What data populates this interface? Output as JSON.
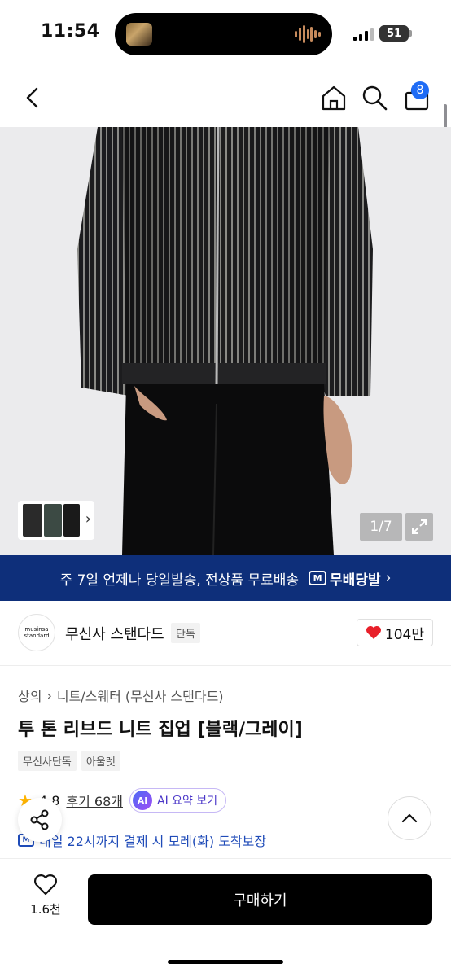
{
  "status_bar": {
    "time": "11:54",
    "battery": "51"
  },
  "nav": {
    "cart_count": "8"
  },
  "gallery": {
    "counter": "1/7"
  },
  "banner": {
    "text": "주 7일 언제나 당일발송, 전상품 무료배송",
    "brand": "무배당발",
    "chevron": "›"
  },
  "brand": {
    "logo_line1": "musinsa",
    "logo_line2": "standard",
    "name": "무신사 스탠다드",
    "exclusive_tag": "단독",
    "likes": "104만",
    "heart_color": "#e8202a"
  },
  "product": {
    "breadcrumb": [
      "상의",
      "니트/스웨터 (무신사 스탠다드)"
    ],
    "title": "투 톤 리브드 니트 집업 [블랙/그레이]",
    "tags": [
      "무신사단독",
      "아울렛"
    ],
    "rating": "4.8",
    "review_link": "후기 68개",
    "ai_badge": "AI",
    "ai_label": "AI 요약 보기",
    "delivery_text": "내일 22시까지 결제 시 모레(화) 도착보장",
    "delivery_badge": "M"
  },
  "bottom_bar": {
    "wish_count": "1.6천",
    "buy_label": "구매하기"
  },
  "colors": {
    "banner_bg": "#0e2f7a",
    "accent_blue": "#1f6cf5",
    "buy_bg": "#000000"
  }
}
